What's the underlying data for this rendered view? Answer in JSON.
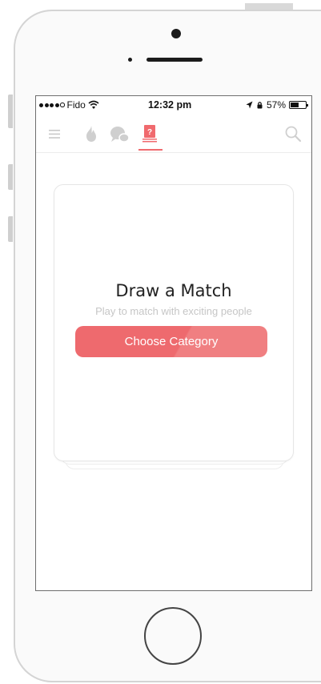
{
  "status_bar": {
    "carrier": "Fido",
    "time": "12:32 pm",
    "battery_text": "57%",
    "battery_level": 0.57
  },
  "nav": {
    "menu_icon": "menu-icon",
    "flame_icon": "flame-icon",
    "chat_icon": "chat-bubbles-icon",
    "active_tab_icon": "question-card-icon",
    "search_icon": "search-icon",
    "accent_color": "#f06a6e"
  },
  "card": {
    "title": "Draw a Match",
    "subtitle": "Play to match with exciting people",
    "button_label": "Choose Category",
    "button_color": "#ee6a6e"
  }
}
